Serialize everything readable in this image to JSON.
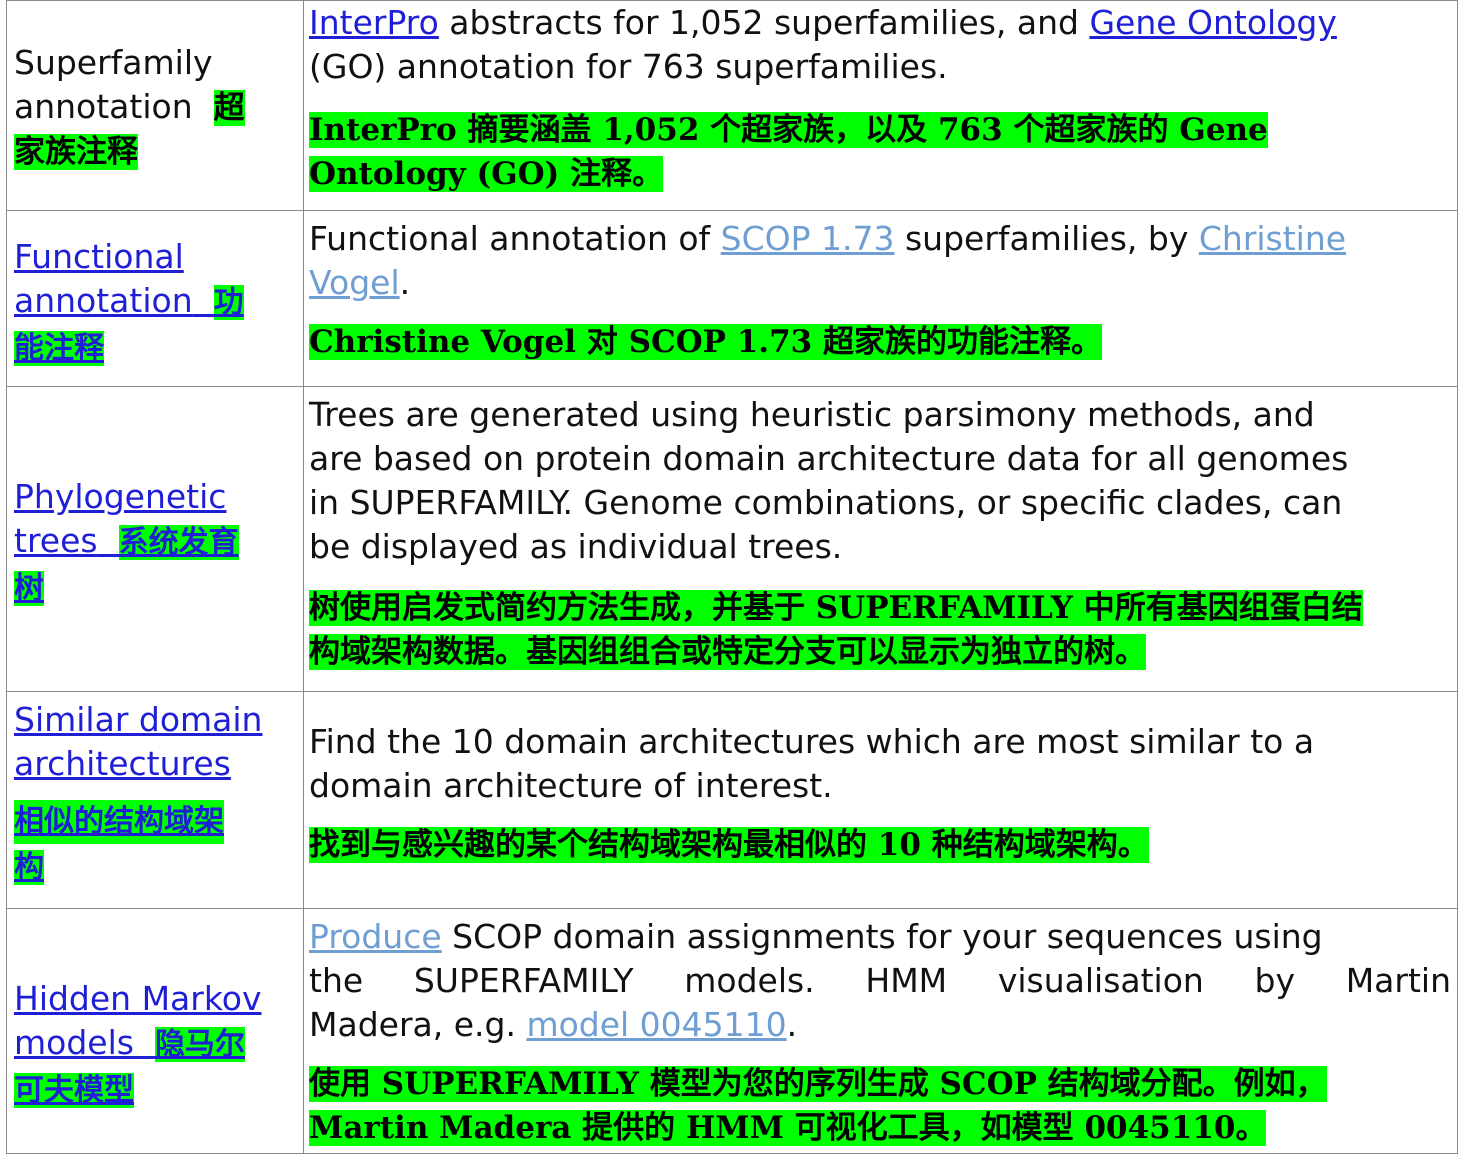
{
  "rows": [
    {
      "label_line1": "Superfamily",
      "label_line2": "annotation",
      "label_zh_1": "超",
      "label_zh_2": "家族注释",
      "desc": {
        "link1": "InterPro",
        "text1": " abstracts for 1,052 superfamilies, and ",
        "link2": "Gene Ontology",
        "text2": "(GO) annotation for 763 superfamilies."
      },
      "zh_1": "InterPro 摘要涵盖 1,052 个超家族，以及 763 个超家族的 Gene",
      "zh_2": "Ontology (GO) 注释。"
    },
    {
      "label_line1": "Functional",
      "label_line2": "annotation",
      "label_zh_1": "功",
      "label_zh_2": "能注释",
      "desc": {
        "text1": "Functional annotation of ",
        "link1": "SCOP 1.73",
        "text2": " superfamilies, by ",
        "link2a": "Christine",
        "link2b": "Vogel",
        "text3": "."
      },
      "zh": "Christine Vogel 对 SCOP 1.73 超家族的功能注释。"
    },
    {
      "label_line1": "Phylogenetic",
      "label_line2": "trees",
      "label_zh_1": "系统发育",
      "label_zh_2": "树",
      "desc_lines": [
        "Trees are generated using heuristic parsimony methods, and",
        "are based on protein domain architecture data for all genomes",
        "in SUPERFAMILY. Genome combinations, or specific clades, can",
        "be displayed as individual trees."
      ],
      "zh_1": "树使用启发式简约方法生成，并基于 SUPERFAMILY 中所有基因组蛋白结",
      "zh_2": "构域架构数据。基因组组合或特定分支可以显示为独立的树。"
    },
    {
      "label_line1": "Similar domain",
      "label_line2": "architectures",
      "label_zh_1": "相似的结构域架",
      "label_zh_2": "构",
      "desc_lines": [
        "Find the 10 domain architectures which are most similar to a",
        "domain architecture of interest."
      ],
      "zh": "找到与感兴趣的某个结构域架构最相似的 10 种结构域架构。"
    },
    {
      "label_line1": "Hidden Markov",
      "label_line2": "models",
      "label_zh_1": "隐马尔",
      "label_zh_2": "可夫模型",
      "desc": {
        "link1": "Produce",
        "text1": " SCOP domain assignments for your sequences using",
        "line2": "the SUPERFAMILY models. HMM visualisation by Martin",
        "text3": "Madera, e.g. ",
        "link2": "model 0045110",
        "text4": "."
      },
      "zh_1": "使用 SUPERFAMILY 模型为您的序列生成 SCOP 结构域分配。例如，",
      "zh_2": "Martin Madera 提供的 HMM 可视化工具，如模型 0045110。"
    }
  ]
}
